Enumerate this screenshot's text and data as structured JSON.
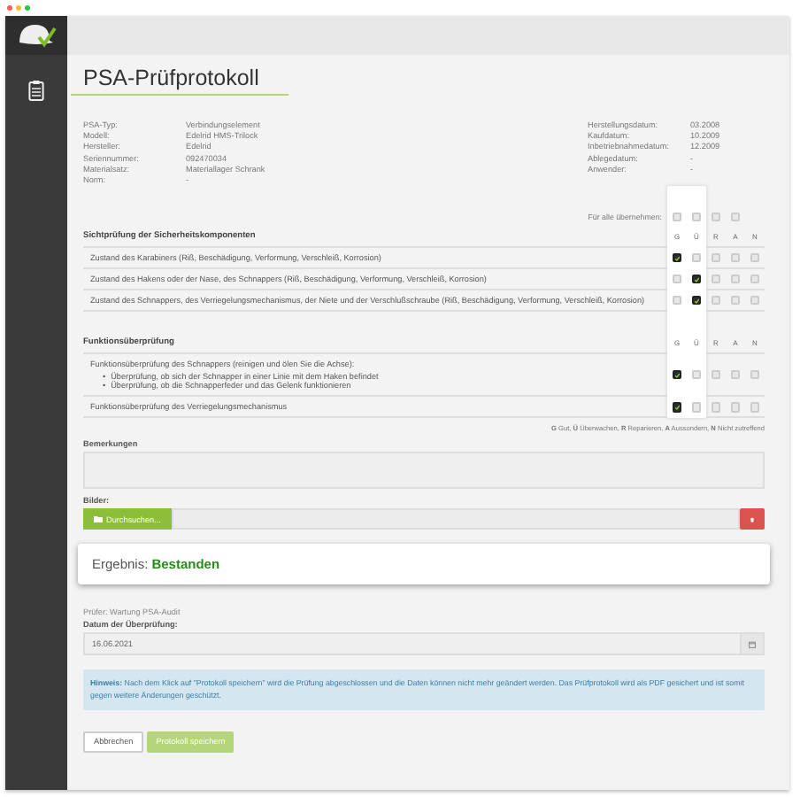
{
  "title": "PSA-Prüfprotokoll",
  "info_left": [
    {
      "label": "PSA-Typ:",
      "value": "Verbindungselement"
    },
    {
      "label": "Modell:",
      "value": "Edelrid HMS-Trilock"
    },
    {
      "label": "Hersteller:",
      "value": "Edelrid"
    },
    {
      "label": "Seriennummer:",
      "value": "092470034"
    },
    {
      "label": "Materialsatz:",
      "value": "Materiallager Schrank"
    },
    {
      "label": "Norm:",
      "value": "-"
    }
  ],
  "info_right": [
    {
      "label": "Herstellungsdatum:",
      "value": "03.2008"
    },
    {
      "label": "Kaufdatum:",
      "value": "10.2009"
    },
    {
      "label": "Inbetriebnahmedatum:",
      "value": "12.2009"
    },
    {
      "label": "Ablegedatum:",
      "value": "-"
    },
    {
      "label": "Anwender:",
      "value": "-"
    }
  ],
  "apply_all": {
    "label": "Für alle übernehmen:",
    "checks": [
      false,
      false,
      false,
      false
    ]
  },
  "sections": [
    {
      "title": "Sichtprüfung der Sicherheitskomponenten",
      "columns": [
        "G",
        "Ü",
        "R",
        "A",
        "N"
      ],
      "rows": [
        {
          "text": "Zustand des Karabiners (Riß, Beschädigung, Verformung, Verschleiß, Korrosion)",
          "checks": [
            true,
            false,
            false,
            false,
            false
          ]
        },
        {
          "text": "Zustand des Hakens oder der Nase, des Schnappers (Riß, Beschädigung, Verformung, Verschleiß, Korrosion)",
          "checks": [
            false,
            true,
            false,
            false,
            false
          ]
        },
        {
          "text": "Zustand des Schnappers, des Verriegelungsmechanismus, der Niete und der Verschlußschraube (Riß, Beschädigung, Verformung, Verschleiß, Korrosion)",
          "checks": [
            false,
            true,
            false,
            false,
            false
          ]
        }
      ]
    },
    {
      "title": "Funktionsüberprüfung",
      "columns": [
        "G",
        "Ü",
        "R",
        "A",
        "N"
      ],
      "rows": [
        {
          "text": "Funktionsüberprüfung des Schnappers (reinigen und ölen Sie die Achse):",
          "bullets": [
            {
              "marker": "•",
              "text": "Überprüfung, ob sich der Schnapper in einer Linie mit dem Haken befindet"
            },
            {
              "marker": "•",
              "text": "Überprüfung, ob die Schnapperfeder und das Gelenk funktionieren"
            }
          ],
          "checks": [
            true,
            false,
            false,
            false,
            false
          ]
        },
        {
          "text": "Funktionsüberprüfung des Verriegelungsmechanismus",
          "checks": [
            true,
            false,
            false,
            false,
            false
          ]
        }
      ]
    }
  ],
  "legend": "**G** Gut, **Ü** Überwachen, **R** Reparieren, **A** Aussondern, **N** Nicht zutreffend",
  "remarks": {
    "label": "Bemerkungen"
  },
  "images": {
    "label": "Bilder:",
    "browse": "Durchsuchen..."
  },
  "result": {
    "label": "Ergebnis:",
    "value": "Bestanden"
  },
  "inspector": "Prüfer: Wartung PSA-Audit",
  "date": {
    "label": "Datum der Überprüfung:",
    "value": "16.06.2021"
  },
  "hint": "**Hinweis:** Nach dem Klick auf \"Protokoll speichern\" wird die Prüfung abgeschlossen und die Daten können nicht mehr geändert werden. Das Prüfprotokoll wird als PDF gesichert und ist somit gegen weitere Änderungen geschützt.",
  "buttons": {
    "cancel": "Abbrechen",
    "save": "Protokoll speichern"
  }
}
